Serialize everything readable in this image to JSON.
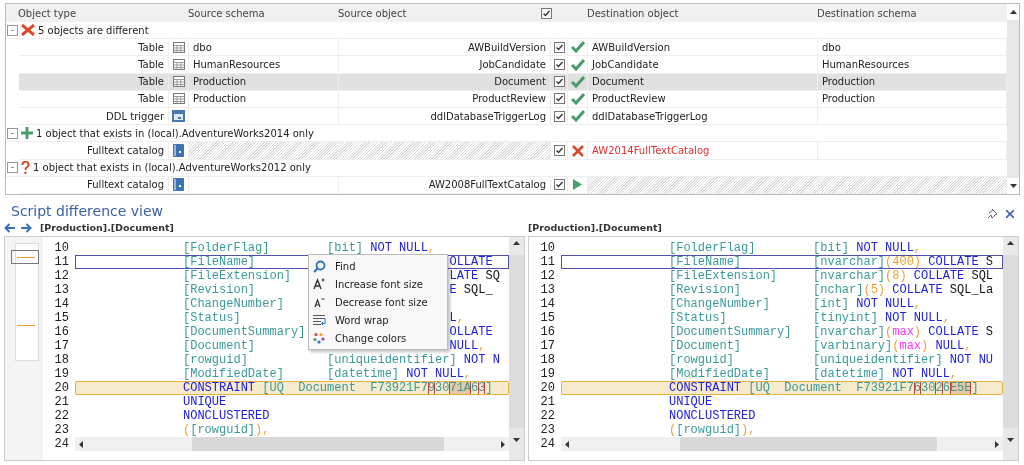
{
  "grid": {
    "columns": {
      "object_type": "Object type",
      "source_schema": "Source schema",
      "source_object": "Source object",
      "include_all_checked": true,
      "destination_object": "Destination object",
      "destination_schema": "Destination schema"
    },
    "groups": [
      {
        "kind": "different",
        "toggle": "-",
        "label": "5 objects are different",
        "rows": [
          {
            "type": "Table",
            "kind": "table",
            "source_missing": false,
            "destination_missing": false,
            "source_schema": "dbo",
            "source_object": "AWBuildVersion",
            "checked": true,
            "status": {
              "kind": "update"
            },
            "destination_object": "AWBuildVersion",
            "destination_schema": "dbo",
            "selected": false
          },
          {
            "type": "Table",
            "kind": "table",
            "source_missing": false,
            "destination_missing": false,
            "source_schema": "HumanResources",
            "source_object": "JobCandidate",
            "checked": true,
            "status": {
              "kind": "update"
            },
            "destination_object": "JobCandidate",
            "destination_schema": "HumanResources",
            "selected": false
          },
          {
            "type": "Table",
            "kind": "table",
            "source_missing": false,
            "destination_missing": false,
            "source_schema": "Production",
            "source_object": "Document",
            "checked": true,
            "status": {
              "kind": "update"
            },
            "destination_object": "Document",
            "destination_schema": "Production",
            "selected": true
          },
          {
            "type": "Table",
            "kind": "table",
            "source_missing": false,
            "destination_missing": false,
            "source_schema": "Production",
            "source_object": "ProductReview",
            "checked": true,
            "status": {
              "kind": "update"
            },
            "destination_object": "ProductReview",
            "destination_schema": "Production",
            "selected": false
          },
          {
            "type": "DDL trigger",
            "kind": "trigger",
            "source_missing": false,
            "destination_missing": false,
            "source_object": "ddlDatabaseTriggerLog",
            "checked": true,
            "status": {
              "kind": "update"
            },
            "destination_object": "ddlDatabaseTriggerLog",
            "selected": false
          }
        ]
      },
      {
        "kind": "added",
        "toggle": "-",
        "label": "1 object that exists in (local).AdventureWorks2014 only",
        "rows": [
          {
            "type": "Fulltext catalog",
            "kind": "catalog",
            "source_missing": true,
            "destination_missing": false,
            "checked": true,
            "status": {
              "kind": "drop"
            },
            "destination_object": "AW2014FullTextCatalog",
            "selected": false
          }
        ]
      },
      {
        "kind": "missing",
        "toggle": "-",
        "label": "1 object that exists in (local).AdventureWorks2012 only",
        "rows": [
          {
            "type": "Fulltext catalog",
            "kind": "catalog",
            "source_missing": false,
            "destination_missing": true,
            "source_object": "AW2008FullTextCatalog",
            "checked": true,
            "status": {
              "kind": "create"
            },
            "selected": false
          }
        ]
      }
    ]
  },
  "diff_view": {
    "title": "Script difference view",
    "panes": [
      {
        "path": "[Production].[Document]",
        "lines": [
          {
            "number": "10",
            "cursor": false,
            "changed": false,
            "tokens": [
              {
                "text": "[FolderFlag]",
                "kind": "column"
              },
              {
                "text": "[bit]",
                "kind": "type"
              },
              {
                "text": " NOT NULL",
                "kind": "keyword"
              },
              {
                "text": ",",
                "kind": "punct"
              }
            ]
          },
          {
            "number": "11",
            "cursor": true,
            "changed": false,
            "tokens": [
              {
                "text": "[FileName]",
                "kind": "column"
              }
            ],
            "after_menu": [
              {
                "text": "OLLATE",
                "kind": "keyword"
              }
            ]
          },
          {
            "number": "12",
            "cursor": false,
            "changed": false,
            "tokens": [
              {
                "text": "[FileExtension]",
                "kind": "column"
              }
            ],
            "after_menu": [
              {
                "text": "LATE",
                "kind": "keyword"
              },
              {
                "text": " SQ",
                "kind": "plain"
              }
            ]
          },
          {
            "number": "13",
            "cursor": false,
            "changed": false,
            "tokens": [
              {
                "text": "[Revision]",
                "kind": "column"
              }
            ],
            "after_menu": [
              {
                "text": "E",
                "kind": "keyword"
              },
              {
                "text": " SQL_",
                "kind": "plain"
              }
            ]
          },
          {
            "number": "14",
            "cursor": false,
            "changed": false,
            "tokens": [
              {
                "text": "[ChangeNumber]",
                "kind": "column"
              }
            ]
          },
          {
            "number": "15",
            "cursor": false,
            "changed": false,
            "tokens": [
              {
                "text": "[Status]",
                "kind": "column"
              }
            ],
            "after_menu": [
              {
                "text": "L",
                "kind": "keyword"
              },
              {
                "text": ",",
                "kind": "punct"
              }
            ]
          },
          {
            "number": "16",
            "cursor": false,
            "changed": false,
            "tokens": [
              {
                "text": "[DocumentSummary]",
                "kind": "column"
              }
            ],
            "after_menu": [
              {
                "text": "OLLATE",
                "kind": "keyword"
              }
            ]
          },
          {
            "number": "17",
            "cursor": false,
            "changed": false,
            "tokens": [
              {
                "text": "[Document]",
                "kind": "column"
              }
            ],
            "after_menu": [
              {
                "text": "NULL",
                "kind": "keyword"
              },
              {
                "text": ",",
                "kind": "punct"
              }
            ]
          },
          {
            "number": "18",
            "cursor": false,
            "changed": false,
            "tokens": [
              {
                "text": "[rowguid]",
                "kind": "column"
              },
              {
                "text": "[uniqueidentifier]",
                "kind": "type"
              },
              {
                "text": " NOT N",
                "kind": "keyword"
              }
            ]
          },
          {
            "number": "19",
            "cursor": false,
            "changed": false,
            "tokens": [
              {
                "text": "[ModifiedDate]",
                "kind": "column"
              },
              {
                "text": "[datetime]",
                "kind": "type"
              },
              {
                "text": " NOT NULL",
                "kind": "keyword"
              },
              {
                "text": ",",
                "kind": "punct"
              }
            ]
          },
          {
            "number": "20",
            "cursor": false,
            "changed": true,
            "tokens": [
              {
                "text": "CONSTRAINT",
                "kind": "keyword"
              },
              {
                "text": " [UQ  Document  F73921F7",
                "kind": "type"
              },
              {
                "text": "9",
                "kind": "diff"
              },
              {
                "text": "30",
                "kind": "type"
              },
              {
                "text": "71A",
                "kind": "diff_block"
              },
              {
                "text": "6",
                "kind": "type"
              },
              {
                "text": "3",
                "kind": "diff"
              },
              {
                "text": "]",
                "kind": "type"
              }
            ]
          },
          {
            "number": "21",
            "cursor": false,
            "changed": false,
            "tokens": [
              {
                "text": "UNIQUE",
                "kind": "keyword"
              }
            ]
          },
          {
            "number": "22",
            "cursor": false,
            "changed": false,
            "tokens": [
              {
                "text": "NONCLUSTERED",
                "kind": "keyword"
              }
            ]
          },
          {
            "number": "23",
            "cursor": false,
            "changed": false,
            "tokens": [
              {
                "text": "(",
                "kind": "punct"
              },
              {
                "text": "[rowguid]",
                "kind": "type"
              },
              {
                "text": "),",
                "kind": "punct"
              }
            ]
          },
          {
            "number": "24",
            "cursor": false,
            "changed": false
          }
        ]
      },
      {
        "path": "[Production].[Document]",
        "lines": [
          {
            "number": "10",
            "cursor": false,
            "changed": false,
            "tokens": [
              {
                "text": "[FolderFlag]",
                "kind": "column"
              },
              {
                "text": "[bit]",
                "kind": "type"
              },
              {
                "text": " NOT NULL",
                "kind": "keyword"
              },
              {
                "text": ",",
                "kind": "punct"
              }
            ]
          },
          {
            "number": "11",
            "cursor": true,
            "changed": false,
            "tokens": [
              {
                "text": "[FileName]",
                "kind": "column"
              },
              {
                "text": "[nvarchar]",
                "kind": "type"
              },
              {
                "text": "(400)",
                "kind": "number"
              },
              {
                "text": " COLLATE",
                "kind": "keyword"
              },
              {
                "text": " S",
                "kind": "plain"
              }
            ]
          },
          {
            "number": "12",
            "cursor": false,
            "changed": false,
            "tokens": [
              {
                "text": "[FileExtension]",
                "kind": "column"
              },
              {
                "text": "[nvarchar]",
                "kind": "type"
              },
              {
                "text": "(8)",
                "kind": "number"
              },
              {
                "text": " COLLATE",
                "kind": "keyword"
              },
              {
                "text": " SQL",
                "kind": "plain"
              }
            ]
          },
          {
            "number": "13",
            "cursor": false,
            "changed": false,
            "tokens": [
              {
                "text": "[Revision]",
                "kind": "column"
              },
              {
                "text": "[nchar]",
                "kind": "type"
              },
              {
                "text": "(5)",
                "kind": "number"
              },
              {
                "text": " COLLATE",
                "kind": "keyword"
              },
              {
                "text": " SQL_La",
                "kind": "plain"
              }
            ]
          },
          {
            "number": "14",
            "cursor": false,
            "changed": false,
            "tokens": [
              {
                "text": "[ChangeNumber]",
                "kind": "column"
              },
              {
                "text": "[int]",
                "kind": "type"
              },
              {
                "text": " NOT NULL",
                "kind": "keyword"
              },
              {
                "text": ",",
                "kind": "punct"
              }
            ]
          },
          {
            "number": "15",
            "cursor": false,
            "changed": false,
            "tokens": [
              {
                "text": "[Status]",
                "kind": "column"
              },
              {
                "text": "[tinyint]",
                "kind": "type"
              },
              {
                "text": " NOT NULL",
                "kind": "keyword"
              },
              {
                "text": ",",
                "kind": "punct"
              }
            ]
          },
          {
            "number": "16",
            "cursor": false,
            "changed": false,
            "tokens": [
              {
                "text": "[DocumentSummary]",
                "kind": "column"
              },
              {
                "text": "[nvarchar]",
                "kind": "type"
              },
              {
                "text": "(",
                "kind": "punct"
              },
              {
                "text": "max",
                "kind": "function"
              },
              {
                "text": ")",
                "kind": "punct"
              },
              {
                "text": " COLLATE",
                "kind": "keyword"
              },
              {
                "text": " S",
                "kind": "plain"
              }
            ]
          },
          {
            "number": "17",
            "cursor": false,
            "changed": false,
            "tokens": [
              {
                "text": "[Document]",
                "kind": "column"
              },
              {
                "text": "[varbinary]",
                "kind": "type"
              },
              {
                "text": "(",
                "kind": "punct"
              },
              {
                "text": "max",
                "kind": "function"
              },
              {
                "text": ")",
                "kind": "punct"
              },
              {
                "text": " NULL",
                "kind": "keyword"
              },
              {
                "text": ",",
                "kind": "punct"
              }
            ]
          },
          {
            "number": "18",
            "cursor": false,
            "changed": false,
            "tokens": [
              {
                "text": "[rowguid]",
                "kind": "column"
              },
              {
                "text": "[uniqueidentifier]",
                "kind": "type"
              },
              {
                "text": " NOT NU",
                "kind": "keyword"
              }
            ]
          },
          {
            "number": "19",
            "cursor": false,
            "changed": false,
            "tokens": [
              {
                "text": "[ModifiedDate]",
                "kind": "column"
              },
              {
                "text": "[datetime]",
                "kind": "type"
              },
              {
                "text": " NOT NULL",
                "kind": "keyword"
              },
              {
                "text": ",",
                "kind": "punct"
              }
            ]
          },
          {
            "number": "20",
            "cursor": false,
            "changed": true,
            "tokens": [
              {
                "text": "CONSTRAINT",
                "kind": "keyword"
              },
              {
                "text": " [UQ  Document  F73921F7",
                "kind": "type"
              },
              {
                "text": "6",
                "kind": "diff"
              },
              {
                "text": "30",
                "kind": "type"
              },
              {
                "text": "2",
                "kind": "diff"
              },
              {
                "text": "6",
                "kind": "type"
              },
              {
                "text": "E5E",
                "kind": "diff_block"
              },
              {
                "text": "]",
                "kind": "type"
              }
            ]
          },
          {
            "number": "21",
            "cursor": false,
            "changed": false,
            "tokens": [
              {
                "text": "UNIQUE",
                "kind": "keyword"
              }
            ]
          },
          {
            "number": "22",
            "cursor": false,
            "changed": false,
            "tokens": [
              {
                "text": "NONCLUSTERED",
                "kind": "keyword"
              }
            ]
          },
          {
            "number": "23",
            "cursor": false,
            "changed": false,
            "tokens": [
              {
                "text": "(",
                "kind": "punct"
              },
              {
                "text": "[rowguid]",
                "kind": "type"
              },
              {
                "text": "),",
                "kind": "punct"
              }
            ]
          },
          {
            "number": "24",
            "cursor": false,
            "changed": false
          }
        ]
      }
    ],
    "context_menu": [
      {
        "label": "Find",
        "kind": "search"
      },
      {
        "label": "Increase font size",
        "kind": "font_up"
      },
      {
        "label": "Decrease font size",
        "kind": "font_down"
      },
      {
        "label": "Word wrap",
        "kind": "wrap"
      },
      {
        "label": "Change colors",
        "kind": "colors"
      }
    ]
  }
}
